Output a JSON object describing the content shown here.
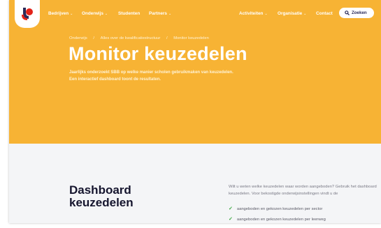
{
  "nav": {
    "items": [
      {
        "label": "Bedrijven",
        "chevron": true
      },
      {
        "label": "Onderwijs",
        "chevron": true
      },
      {
        "label": "Studenten",
        "chevron": false
      },
      {
        "label": "Partners",
        "chevron": true
      },
      {
        "label": "Activiteiten",
        "chevron": true
      },
      {
        "label": "Organisatie",
        "chevron": true
      },
      {
        "label": "Contact",
        "chevron": false
      }
    ],
    "search_label": "Zoeken",
    "chevron_glyph": "⌄"
  },
  "breadcrumb": {
    "items": [
      "Onderwijs",
      "Alles over de kwalificatiestructuur",
      "Monitor keuzedelen"
    ],
    "separator": "/"
  },
  "hero": {
    "title": "Monitor keuzedelen",
    "intro": "Jaarlijks onderzoekt SBB op welke manier scholen gebruikmaken van keuzedelen. Een interactief dashboard toont de resultaten."
  },
  "dashboard": {
    "title": "Dashboard keuzedelen",
    "description": "Wilt u weten welke keuzedelen waar worden aangeboden? Gebruik het dashboard keuzedelen. Voor bekostigde onderwijsinstellingen vindt u de",
    "checklist": [
      "aangeboden en gekozen keuzedelen per sector",
      "aangeboden en gekozen keuzedelen per leerweg"
    ],
    "check_glyph": "✓"
  },
  "colors": {
    "hero_bg": "#f7b334",
    "section_bg": "#f4f5f7",
    "logo_red": "#e2231a",
    "logo_navy": "#2b2b5a",
    "check_green": "#35a63a"
  },
  "icons": {
    "logo": "sbb-logo",
    "search": "search-icon",
    "check": "check-icon"
  }
}
